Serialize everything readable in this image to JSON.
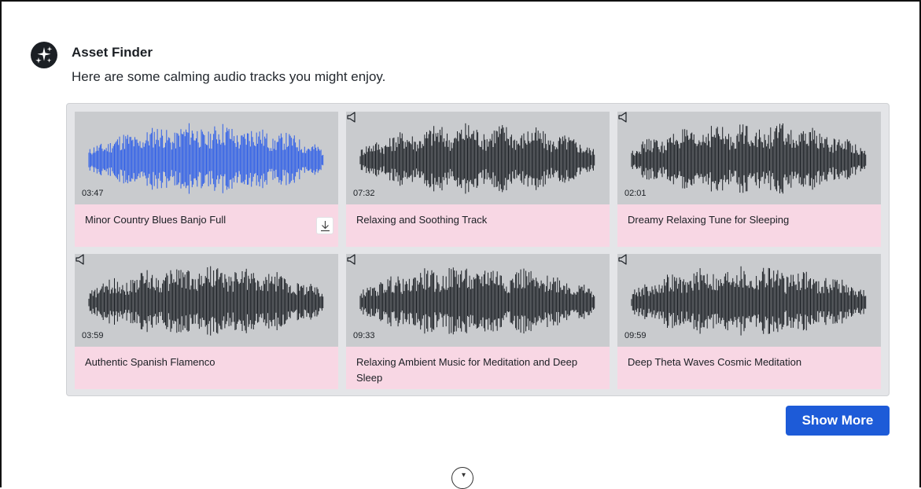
{
  "assistant": {
    "name": "Asset Finder",
    "message": "Here are some calming audio tracks you might enjoy."
  },
  "tracks": [
    {
      "title": "Minor Country Blues Banjo Full",
      "duration": "03:47",
      "wave_color": "#2f5fe8",
      "hovered": true
    },
    {
      "title": "Relaxing and Soothing Track",
      "duration": "07:32",
      "wave_color": "#1b1f24",
      "hovered": false
    },
    {
      "title": "Dreamy Relaxing Tune for Sleeping",
      "duration": "02:01",
      "wave_color": "#1b1f24",
      "hovered": false
    },
    {
      "title": "Authentic Spanish Flamenco",
      "duration": "03:59",
      "wave_color": "#1b1f24",
      "hovered": false
    },
    {
      "title": "Relaxing Ambient Music for Meditation and Deep Sleep",
      "duration": "09:33",
      "wave_color": "#1b1f24",
      "hovered": false
    },
    {
      "title": "Deep Theta Waves Cosmic Meditation",
      "duration": "09:59",
      "wave_color": "#1b1f24",
      "hovered": false
    }
  ],
  "show_more_label": "Show More",
  "colors": {
    "accent": "#1d5bd8",
    "card_info_bg": "#f8d7e4",
    "wave_bg": "#c9cbce"
  },
  "icons": {
    "avatar": "sparkles-icon",
    "speaker": "speaker-icon",
    "download": "download-icon"
  }
}
